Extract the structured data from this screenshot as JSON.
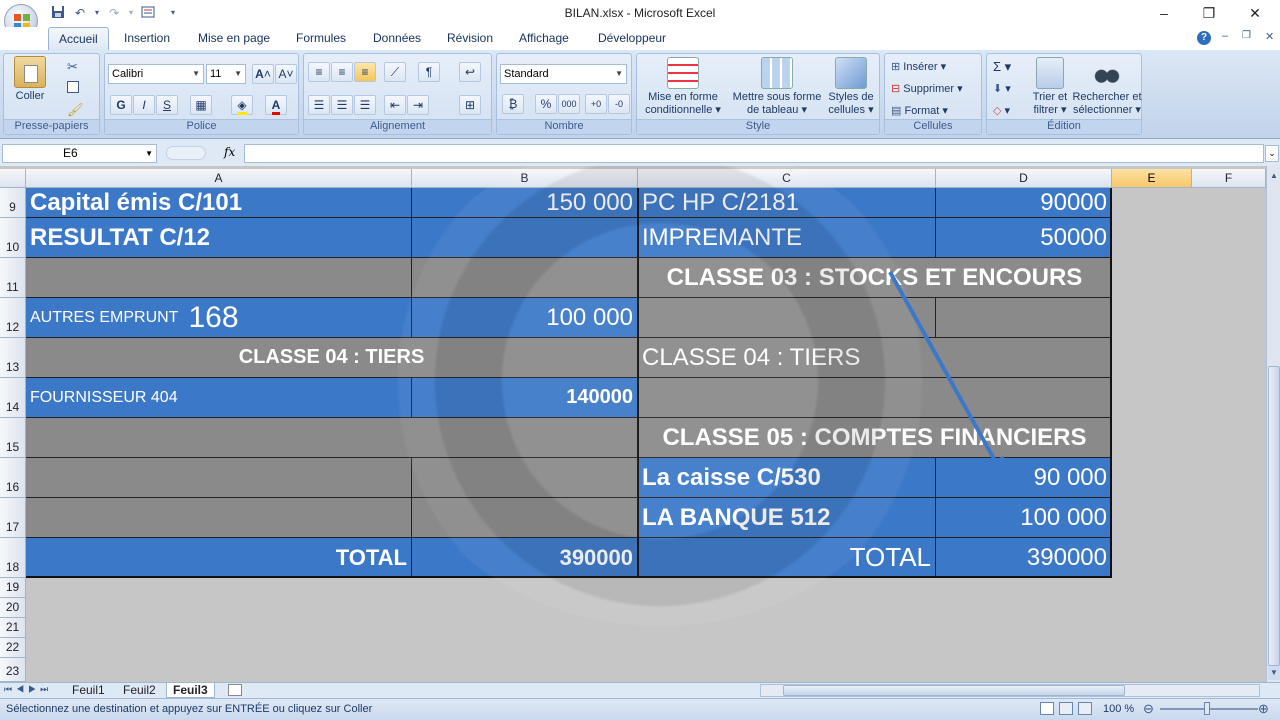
{
  "window": {
    "title": "BILAN.xlsx - Microsoft Excel",
    "minimize": "–",
    "restore": "❐",
    "close": "✕"
  },
  "ribbon": {
    "tabs": [
      "Accueil",
      "Insertion",
      "Mise en page",
      "Formules",
      "Données",
      "Révision",
      "Affichage",
      "Développeur"
    ],
    "clipboard": {
      "paste": "Coller",
      "label": "Presse-papiers"
    },
    "font": {
      "name": "Calibri",
      "size": "11",
      "bold": "G",
      "italic": "I",
      "underline": "S",
      "label": "Police"
    },
    "alignment": {
      "label": "Alignement"
    },
    "number": {
      "format": "Standard",
      "label": "Nombre",
      "percent": "%",
      "thousands": "000"
    },
    "style": {
      "conditional": [
        "Mise en forme",
        "conditionnelle"
      ],
      "as_table": [
        "Mettre sous forme",
        "de tableau"
      ],
      "cell_styles": [
        "Styles de",
        "cellules"
      ],
      "label": "Style"
    },
    "cells": {
      "insert": "Insérer",
      "delete": "Supprimer",
      "format": "Format",
      "label": "Cellules"
    },
    "editing": {
      "sort": [
        "Trier et",
        "filtrer"
      ],
      "find": [
        "Rechercher et",
        "sélectionner"
      ],
      "label": "Édition"
    }
  },
  "formula_bar": {
    "name_box": "E6",
    "fx": "fx",
    "content": ""
  },
  "sheet": {
    "columns": [
      "A",
      "B",
      "C",
      "D",
      "E",
      "F"
    ],
    "selected_column": "E",
    "rows": [
      "9",
      "10",
      "11",
      "12",
      "13",
      "14",
      "15",
      "16",
      "17",
      "18",
      "19",
      "20",
      "21",
      "22",
      "23"
    ],
    "cells": {
      "a9": "Capital émis C/101",
      "b9": "150 000",
      "c9": "PC HP C/2181",
      "d9": "90000",
      "a10": "RESULTAT C/12",
      "c10": "IMPREMANTE",
      "d10": "50000",
      "c11": "CLASSE 03 : STOCKS ET ENCOURS",
      "a12_prefix": "AUTRES EMPRUNT",
      "a12_num": "168",
      "b12": "100 000",
      "a13_bold": "CLASSE 04",
      "a13_rest": " : TIERS",
      "c13": "CLASSE 04 : TIERS",
      "a14": "FOURNISSEUR 404",
      "b14": "140000",
      "c15": "CLASSE 05 : COMPTES FINANCIERS",
      "c16": "La caisse C/530",
      "d16": "90 000",
      "c17": "LA BANQUE 512",
      "d17": "100 000",
      "a18": "TOTAL",
      "b18": "390000",
      "c18": "TOTAL",
      "d18": "390000"
    }
  },
  "sheet_tabs": [
    "Feuil1",
    "Feuil2",
    "Feuil3"
  ],
  "active_sheet": "Feuil3",
  "status": {
    "message": "Sélectionnez une destination et appuyez sur ENTRÉE ou cliquez sur Coller",
    "zoom": "100 %"
  },
  "colors": {
    "table_blue": "#3c78c8",
    "grey_fill": "#8a8a8a",
    "selected_header": "#f7c768"
  }
}
